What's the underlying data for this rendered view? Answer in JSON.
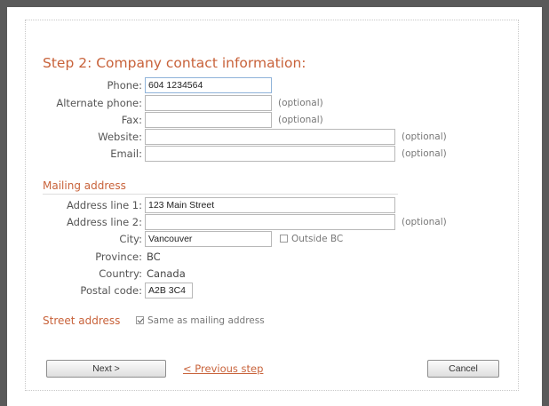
{
  "step_title": "Step 2: Company contact information:",
  "contact": {
    "phone": {
      "label": "Phone:",
      "value": "604 1234564"
    },
    "alt_phone": {
      "label": "Alternate phone:",
      "value": "",
      "note": "(optional)"
    },
    "fax": {
      "label": "Fax:",
      "value": "",
      "note": "(optional)"
    },
    "website": {
      "label": "Website:",
      "value": "",
      "note": "(optional)"
    },
    "email": {
      "label": "Email:",
      "value": "",
      "note": "(optional)"
    }
  },
  "mailing": {
    "heading": "Mailing address",
    "line1": {
      "label": "Address line 1:",
      "value": "123 Main Street"
    },
    "line2": {
      "label": "Address line 2:",
      "value": "",
      "note": "(optional)"
    },
    "city": {
      "label": "City:",
      "value": "Vancouver",
      "outside_label": "Outside BC",
      "outside_checked": false
    },
    "province": {
      "label": "Province:",
      "value": "BC"
    },
    "country": {
      "label": "Country:",
      "value": "Canada"
    },
    "postal": {
      "label": "Postal code:",
      "value": "A2B 3C4"
    }
  },
  "street": {
    "heading": "Street address",
    "same_label": "Same as mailing address",
    "same_checked": true
  },
  "buttons": {
    "next": "Next >",
    "previous": "< Previous step",
    "cancel": "Cancel"
  },
  "colors": {
    "accent": "#c8623a",
    "frame": "#5a5a5a"
  }
}
